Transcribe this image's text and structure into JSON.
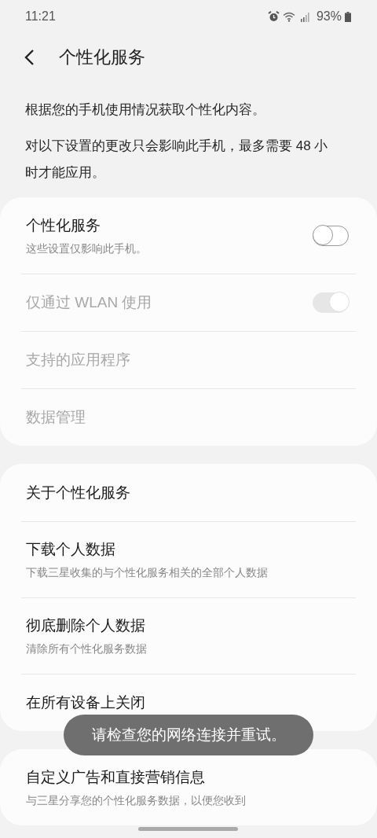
{
  "status_bar": {
    "time": "11:21",
    "battery": "93%"
  },
  "header": {
    "title": "个性化服务"
  },
  "intro": [
    "根据您的手机使用情况获取个性化内容。",
    "对以下设置的更改只会影响此手机，最多需要 48 小时才能应用。"
  ],
  "cards": [
    {
      "items": [
        {
          "kind": "toggle",
          "title": "个性化服务",
          "subtitle": "这些设置仅影响此手机。",
          "on": false,
          "disabled": false
        },
        {
          "kind": "toggle",
          "title": "仅通过 WLAN 使用",
          "on": true,
          "disabled": true
        },
        {
          "kind": "plain",
          "title": "支持的应用程序",
          "disabled": true
        },
        {
          "kind": "plain",
          "title": "数据管理",
          "disabled": true
        }
      ]
    },
    {
      "items": [
        {
          "kind": "plain",
          "title": "关于个性化服务",
          "disabled": false
        },
        {
          "kind": "plain",
          "title": "下载个人数据",
          "subtitle": "下载三星收集的与个性化服务相关的全部个人数据",
          "disabled": false
        },
        {
          "kind": "plain",
          "title": "彻底删除个人数据",
          "subtitle": "清除所有个性化服务数据",
          "disabled": false
        },
        {
          "kind": "plain",
          "title": "在所有设备上关闭",
          "disabled": false
        }
      ]
    },
    {
      "items": [
        {
          "kind": "plain",
          "title": "自定义广告和直接营销信息",
          "subtitle": "与三星分享您的个性化服务数据，以便您收到",
          "disabled": false
        }
      ]
    }
  ],
  "toast": {
    "message": "请检查您的网络连接并重试。"
  }
}
